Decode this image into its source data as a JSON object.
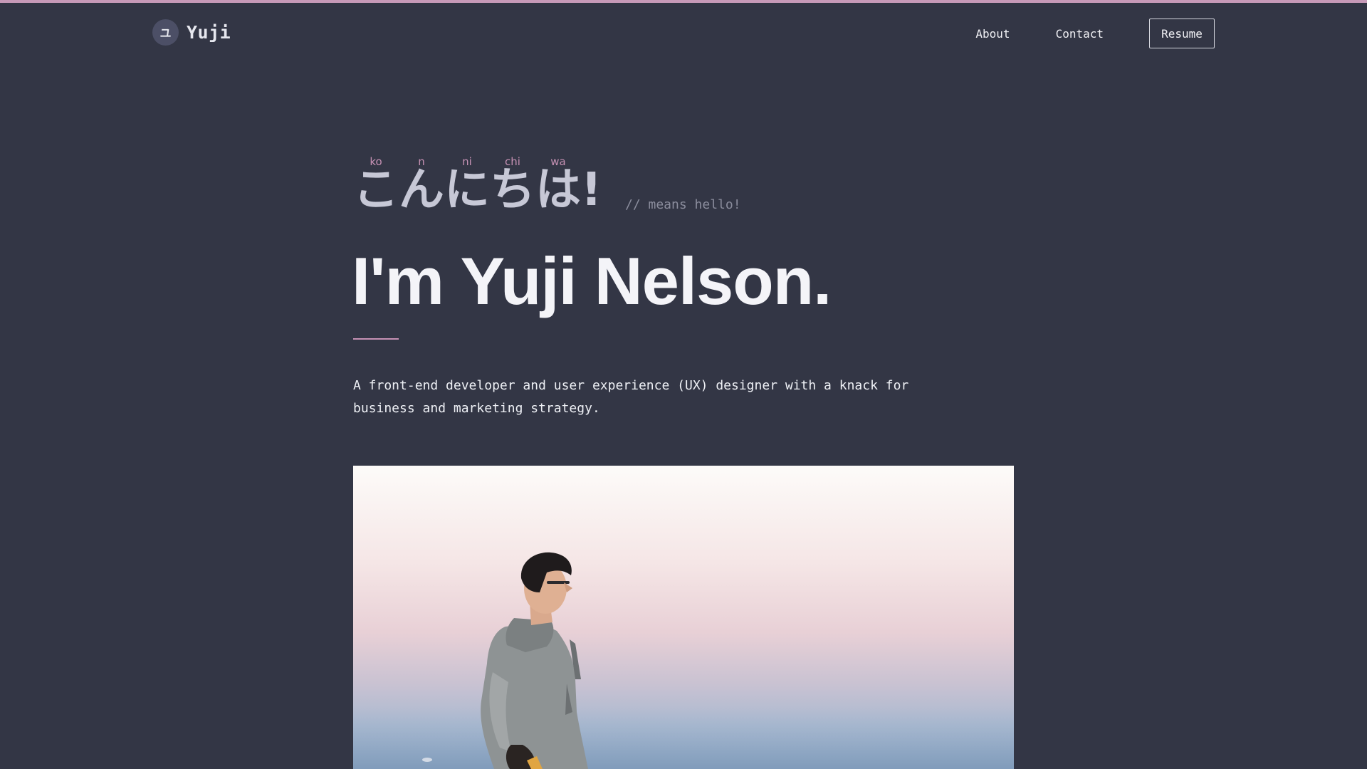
{
  "header": {
    "logo_glyph": "ユ",
    "logo_name": "Yuji",
    "nav": {
      "about": "About",
      "contact": "Contact",
      "resume": "Resume"
    }
  },
  "hero": {
    "greeting": [
      {
        "kana": "こ",
        "romaji": "ko"
      },
      {
        "kana": "ん",
        "romaji": "n"
      },
      {
        "kana": "に",
        "romaji": "ni"
      },
      {
        "kana": "ち",
        "romaji": "chi"
      },
      {
        "kana": "は",
        "romaji": "wa"
      },
      {
        "kana": "!",
        "romaji": ""
      }
    ],
    "greeting_note": "// means hello!",
    "title": "I'm Yuji Nelson.",
    "intro": "A front-end developer and user experience (UX) designer with a knack for business and marketing strategy."
  },
  "colors": {
    "background": "#333645",
    "accent": "#c691b4",
    "heading": "#f4f4f8"
  }
}
